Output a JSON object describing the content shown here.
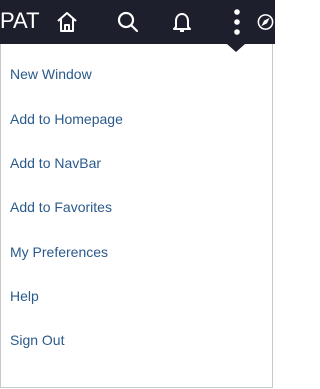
{
  "topbar": {
    "title": "PAT",
    "icons": [
      "home-icon",
      "search-icon",
      "bell-icon",
      "more-vertical-icon",
      "compass-icon"
    ]
  },
  "menu": {
    "items": [
      {
        "label": "New Window"
      },
      {
        "label": "Add to Homepage"
      },
      {
        "label": "Add to NavBar"
      },
      {
        "label": "Add to Favorites"
      },
      {
        "label": "My Preferences"
      },
      {
        "label": "Help"
      },
      {
        "label": "Sign Out"
      }
    ]
  },
  "colors": {
    "topbar_bg": "#1d1f2c",
    "menu_link": "#2a5a8c",
    "menu_border": "#c9c9c9"
  }
}
